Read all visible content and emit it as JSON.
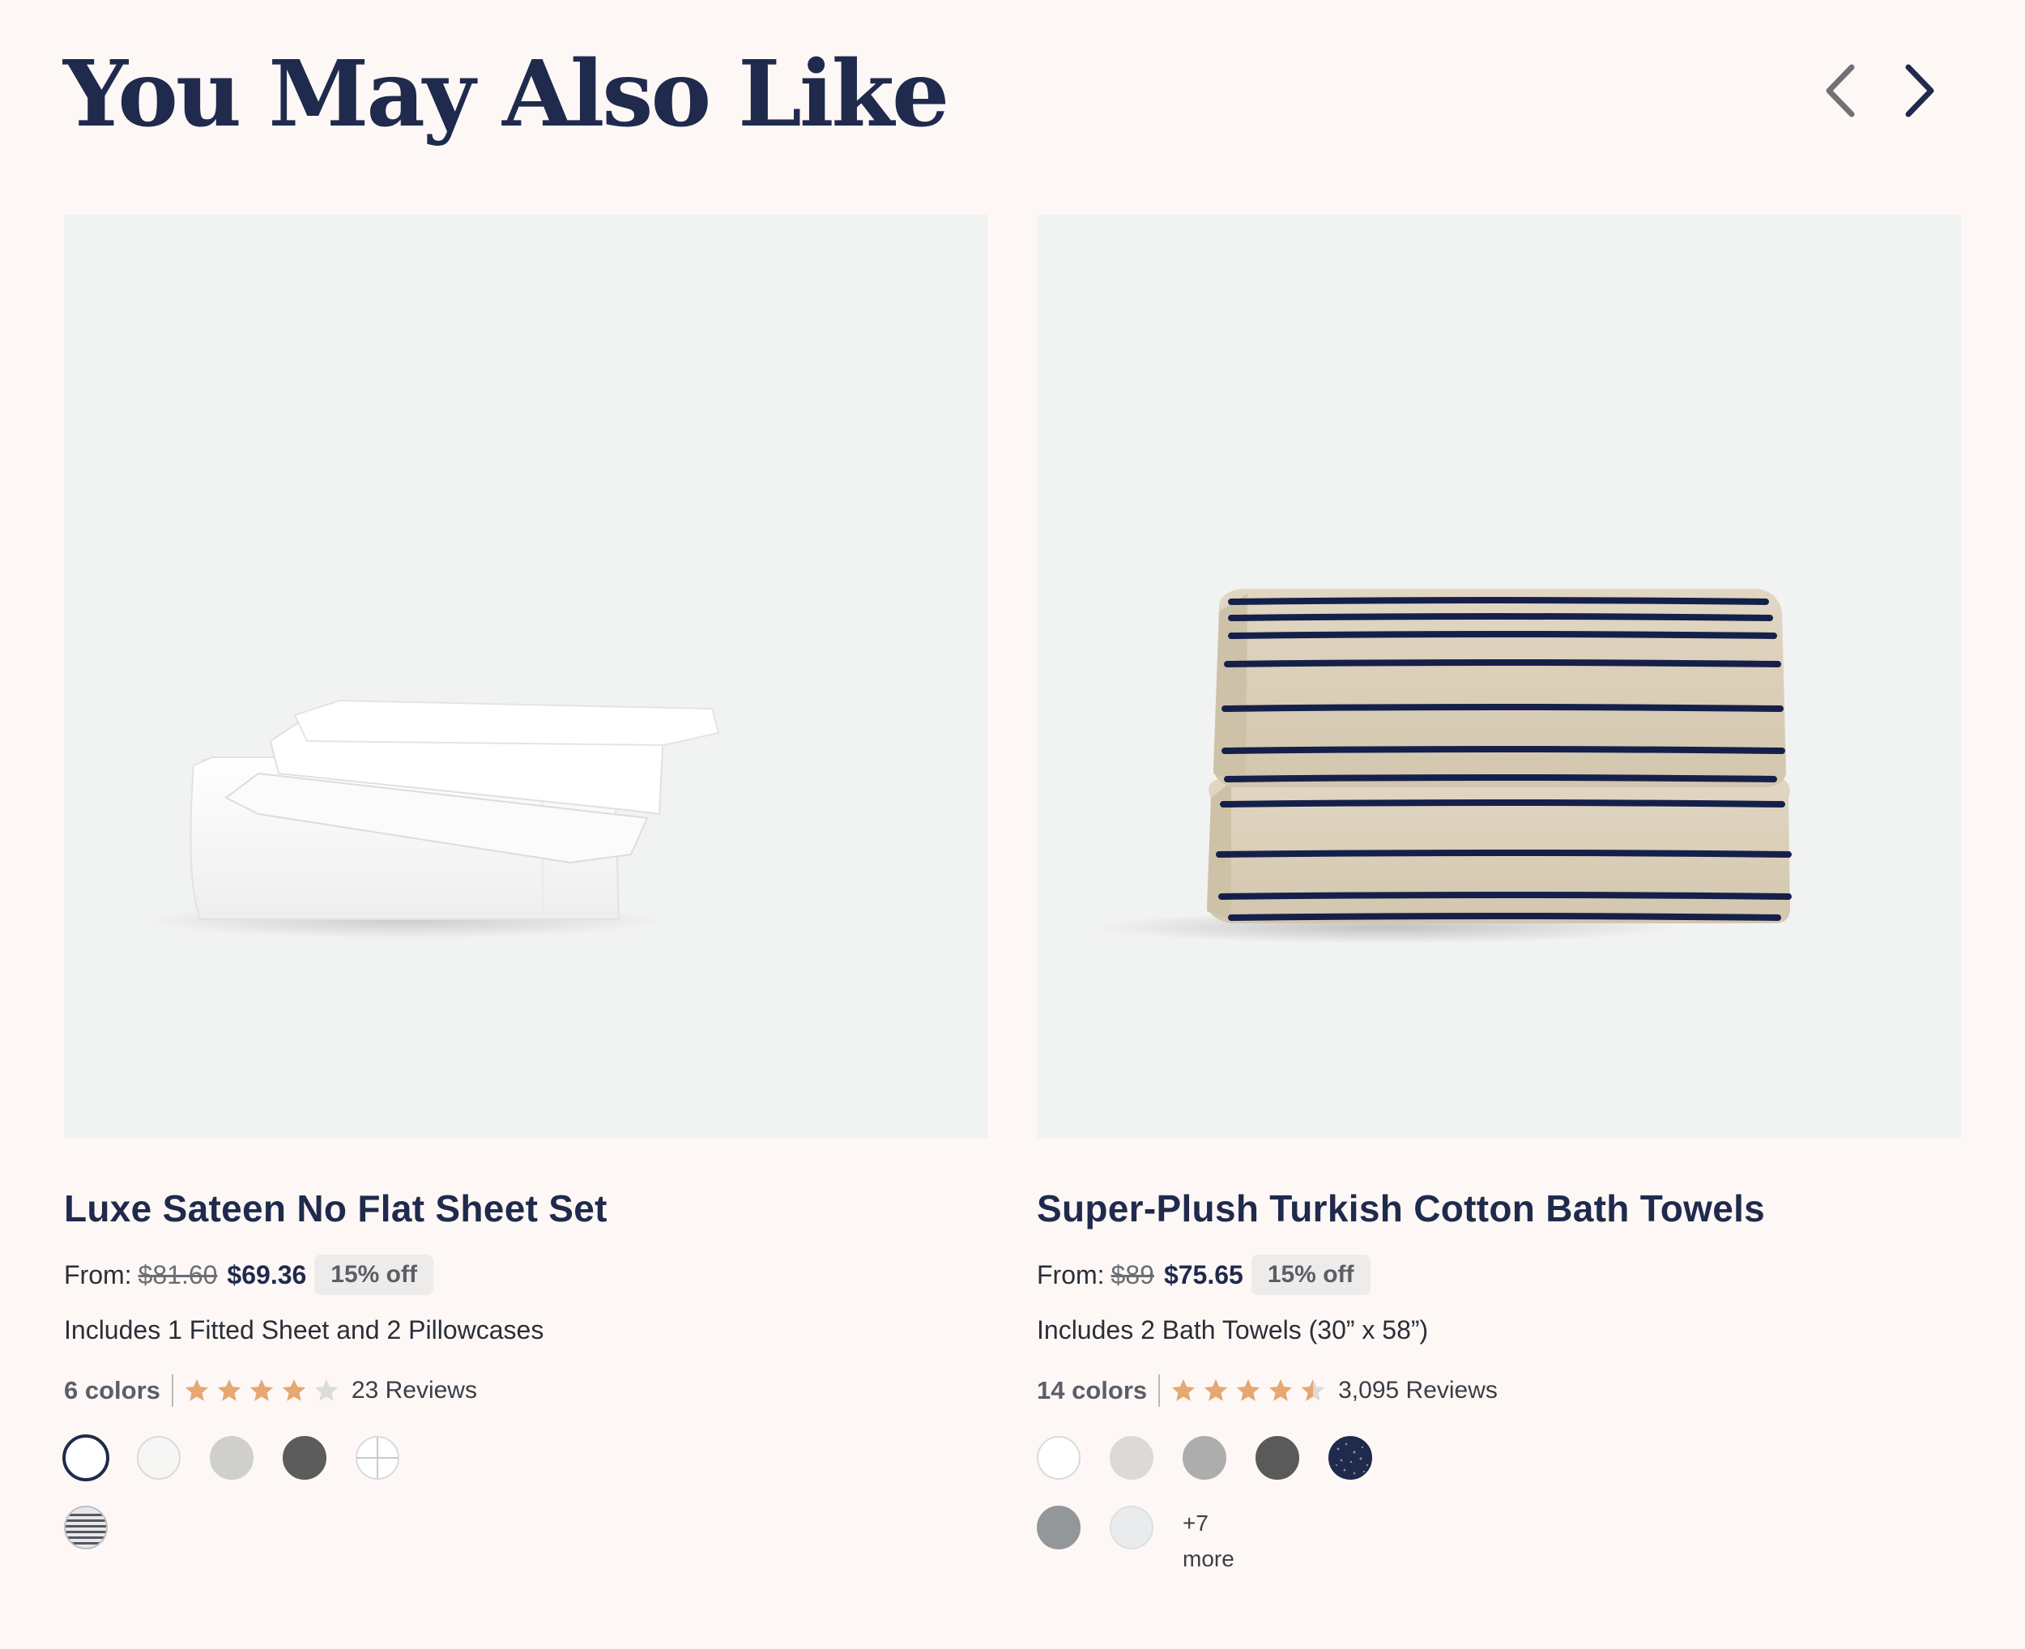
{
  "section": {
    "title": "You May Also Like"
  },
  "nav": {
    "prev_icon": "chevron-left-icon",
    "next_icon": "chevron-right-icon"
  },
  "products": [
    {
      "title": "Luxe Sateen No Flat Sheet Set",
      "from_label": "From:",
      "old_price": "$81.60",
      "price": "$69.36",
      "discount": "15% off",
      "includes": "Includes 1 Fitted Sheet and 2 Pillowcases",
      "colors_count": "6 colors",
      "rating": 4,
      "reviews": "23 Reviews",
      "swatches": [
        "#ffffff",
        "#f7f6f4",
        "#cfcfcd",
        "#5c5c5c",
        "white-grid-pattern",
        "navy-stripe-pattern"
      ]
    },
    {
      "title": "Super-Plush Turkish Cotton Bath Towels",
      "from_label": "From:",
      "old_price": "$89",
      "price": "$75.65",
      "discount": "15% off",
      "includes": "Includes 2 Bath Towels (30” x 58”)",
      "colors_count": "14 colors",
      "rating": 4.5,
      "reviews": "3,095 Reviews",
      "swatches": [
        "#ffffff",
        "#dcdad6",
        "#adadad",
        "#5a5a5a",
        "navy-speckle-pattern",
        "#939799",
        "#eaebed"
      ],
      "more_count": "+7",
      "more_label": "more"
    }
  ],
  "colors": {
    "navy": "#1f2a4d",
    "star": "#e6a772",
    "star_empty": "#d9d9d9",
    "background": "#fdf8f6",
    "image_bg": "#f1f2f2",
    "stripe": "#15204a",
    "towel": "#d9cdb8"
  }
}
